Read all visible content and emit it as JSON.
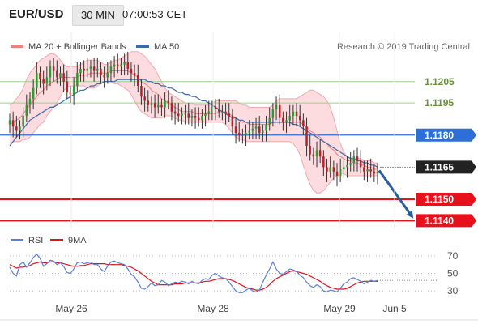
{
  "header": {
    "symbol": "EUR/USD",
    "timeframe": "30 MIN",
    "time": "07:00:53 CET"
  },
  "legend": {
    "ma20_bb": "MA 20 + Bollinger Bands",
    "ma50": "MA 50",
    "credit": "Research © 2019 Trading Central"
  },
  "rsi_legend": {
    "rsi": "RSI",
    "ma9": "9MA"
  },
  "colors": {
    "candle_up": "#2e9a2e",
    "candle_down": "#b8202a",
    "bollinger_fill": "#fbd0d4",
    "bollinger_line": "#f2a8ae",
    "ma20": "#f08080",
    "ma50": "#3a6aa8",
    "support_resistance_green": "#9bd08a",
    "current_level_blue": "#2d6fd6",
    "support_red": "#e8101a",
    "forecast_arrow": "#2a5ca0",
    "current_price_badge": "#222222",
    "rsi": "#5b7fd8",
    "rsi_ma9": "#e8101a"
  },
  "chart_data": [
    {
      "type": "candlestick",
      "title": "EUR/USD 30 MIN",
      "ylim": [
        1.1136,
        1.1228
      ],
      "x_ticks": [
        "May 26",
        "May 28",
        "May 29",
        "Jun 5"
      ],
      "levels": [
        {
          "value": 1.1205,
          "label": "1.1205",
          "style": "green"
        },
        {
          "value": 1.1195,
          "label": "1.1195",
          "style": "green"
        },
        {
          "value": 1.118,
          "label": "1.1180",
          "style": "blue"
        },
        {
          "value": 1.1165,
          "label": "1.1165",
          "style": "current_price"
        },
        {
          "value": 1.115,
          "label": "1.1150",
          "style": "red"
        },
        {
          "value": 1.114,
          "label": "1.1140",
          "style": "red"
        }
      ],
      "current_price": 1.1165,
      "forecast": {
        "from": 1.1165,
        "to": 1.114
      },
      "close": [
        1.1187,
        1.1184,
        1.1182,
        1.1184,
        1.1189,
        1.1194,
        1.1197,
        1.1202,
        1.1209,
        1.1206,
        1.1204,
        1.1207,
        1.1212,
        1.121,
        1.1207,
        1.1209,
        1.1205,
        1.12,
        1.1199,
        1.1203,
        1.1209,
        1.1211,
        1.121,
        1.1211,
        1.1212,
        1.121,
        1.1211,
        1.1208,
        1.1207,
        1.1209,
        1.1212,
        1.1213,
        1.1212,
        1.1213,
        1.1214,
        1.1211,
        1.1209,
        1.1208,
        1.1203,
        1.1198,
        1.1196,
        1.1194,
        1.1195,
        1.1193,
        1.1194,
        1.1193,
        1.1196,
        1.1195,
        1.1191,
        1.119,
        1.1189,
        1.119,
        1.119,
        1.1188,
        1.1189,
        1.1188,
        1.1187,
        1.1189,
        1.119,
        1.1191,
        1.1193,
        1.1192,
        1.1191,
        1.1191,
        1.119,
        1.1189,
        1.1184,
        1.1181,
        1.118,
        1.118,
        1.1181,
        1.1182,
        1.1183,
        1.1184,
        1.1181,
        1.1182,
        1.1185,
        1.1188,
        1.1192,
        1.1194,
        1.1188,
        1.1186,
        1.1187,
        1.1189,
        1.1191,
        1.1189,
        1.1187,
        1.1184,
        1.1175,
        1.1171,
        1.117,
        1.1173,
        1.117,
        1.1165,
        1.1163,
        1.1165,
        1.1163,
        1.1161,
        1.1164,
        1.1165,
        1.1166,
        1.1167,
        1.117,
        1.1168,
        1.1165,
        1.1163,
        1.1164,
        1.1163,
        1.1162,
        1.1163
      ],
      "ma20": [
        1.1185,
        1.1186,
        1.1187,
        1.1188,
        1.119,
        1.1192,
        1.1194,
        1.1196,
        1.1198,
        1.12,
        1.1201,
        1.1203,
        1.1204,
        1.1205,
        1.1206,
        1.1207,
        1.1207,
        1.1207,
        1.1207,
        1.1207,
        1.1207,
        1.1208,
        1.1208,
        1.1208,
        1.1209,
        1.1209,
        1.1209,
        1.1209,
        1.1209,
        1.1209,
        1.121,
        1.121,
        1.121,
        1.121,
        1.121,
        1.121,
        1.1209,
        1.1208,
        1.1207,
        1.1205,
        1.1204,
        1.1203,
        1.1201,
        1.12,
        1.1199,
        1.1197,
        1.1196,
        1.1195,
        1.1194,
        1.1193,
        1.1192,
        1.1191,
        1.1191,
        1.1191,
        1.1191,
        1.119,
        1.119,
        1.119,
        1.119,
        1.119,
        1.119,
        1.119,
        1.1191,
        1.1191,
        1.119,
        1.119,
        1.1189,
        1.1188,
        1.1187,
        1.1186,
        1.1186,
        1.1185,
        1.1185,
        1.1185,
        1.1185,
        1.1185,
        1.1185,
        1.1185,
        1.1186,
        1.1186,
        1.1186,
        1.1186,
        1.1186,
        1.1186,
        1.1186,
        1.1186,
        1.1186,
        1.1185,
        1.1184,
        1.1182,
        1.1181,
        1.118,
        1.1179,
        1.1177,
        1.1176,
        1.1174,
        1.1173,
        1.1171,
        1.117,
        1.1169,
        1.1168,
        1.1168,
        1.1167,
        1.1167,
        1.1166,
        1.1166,
        1.1165,
        1.1165,
        1.1164,
        1.1164
      ],
      "bb_upper": [
        1.1194,
        1.1195,
        1.1197,
        1.1199,
        1.1202,
        1.1206,
        1.1209,
        1.1211,
        1.1213,
        1.1215,
        1.1216,
        1.1217,
        1.1218,
        1.1218,
        1.1217,
        1.1215,
        1.1213,
        1.1212,
        1.1212,
        1.1212,
        1.1212,
        1.1213,
        1.1214,
        1.1215,
        1.1215,
        1.1215,
        1.1215,
        1.1214,
        1.1213,
        1.1213,
        1.1214,
        1.1215,
        1.1215,
        1.1216,
        1.1217,
        1.1218,
        1.1219,
        1.1219,
        1.1219,
        1.1218,
        1.1217,
        1.1215,
        1.1213,
        1.1211,
        1.1208,
        1.1205,
        1.1202,
        1.12,
        1.1199,
        1.1198,
        1.1197,
        1.1196,
        1.1195,
        1.1195,
        1.1195,
        1.1194,
        1.1194,
        1.1194,
        1.1194,
        1.1194,
        1.1195,
        1.1196,
        1.1196,
        1.1196,
        1.1196,
        1.1196,
        1.1196,
        1.1196,
        1.1195,
        1.1194,
        1.1194,
        1.1193,
        1.1193,
        1.1193,
        1.1193,
        1.1193,
        1.1193,
        1.1193,
        1.1194,
        1.1196,
        1.1197,
        1.1197,
        1.1197,
        1.1197,
        1.1197,
        1.1197,
        1.1198,
        1.1199,
        1.12,
        1.1201,
        1.1201,
        1.12,
        1.1199,
        1.1198,
        1.1196,
        1.1193,
        1.1188,
        1.1182,
        1.1176,
        1.1172,
        1.117,
        1.1169,
        1.1169,
        1.1169,
        1.1169,
        1.1168,
        1.1168,
        1.1168,
        1.1167,
        1.1167
      ],
      "bb_lower": [
        1.1176,
        1.1177,
        1.1177,
        1.1177,
        1.1178,
        1.1178,
        1.1179,
        1.1181,
        1.1183,
        1.1185,
        1.1186,
        1.1189,
        1.1191,
        1.1193,
        1.1195,
        1.1198,
        1.1201,
        1.1202,
        1.1203,
        1.1203,
        1.1203,
        1.1203,
        1.1203,
        1.1202,
        1.1202,
        1.1202,
        1.1203,
        1.1204,
        1.1205,
        1.1205,
        1.1205,
        1.1204,
        1.1204,
        1.1203,
        1.1202,
        1.1201,
        1.1199,
        1.1196,
        1.1193,
        1.1191,
        1.119,
        1.1189,
        1.1188,
        1.1188,
        1.1188,
        1.1188,
        1.1189,
        1.1189,
        1.1189,
        1.1188,
        1.1187,
        1.1187,
        1.1186,
        1.1186,
        1.1186,
        1.1186,
        1.1186,
        1.1186,
        1.1186,
        1.1186,
        1.1186,
        1.1186,
        1.1186,
        1.1186,
        1.1185,
        1.1183,
        1.1181,
        1.1179,
        1.1178,
        1.1178,
        1.1177,
        1.1177,
        1.1177,
        1.1177,
        1.1177,
        1.1177,
        1.1177,
        1.1177,
        1.1177,
        1.1177,
        1.1177,
        1.1177,
        1.1177,
        1.1177,
        1.1176,
        1.1174,
        1.1171,
        1.1166,
        1.1161,
        1.1157,
        1.1154,
        1.1153,
        1.1153,
        1.1154,
        1.1156,
        1.1158,
        1.116,
        1.1161,
        1.1162,
        1.1162,
        1.1161,
        1.1161,
        1.1161,
        1.1161,
        1.1161,
        1.1161,
        1.1161,
        1.1161,
        1.1161,
        1.1161
      ],
      "ma50": [
        1.1175,
        1.1177,
        1.1179,
        1.1181,
        1.1183,
        1.1185,
        1.1187,
        1.1188,
        1.1189,
        1.119,
        1.1191,
        1.1192,
        1.1193,
        1.1193,
        1.1194,
        1.1195,
        1.1196,
        1.1197,
        1.1198,
        1.1199,
        1.12,
        1.1201,
        1.1201,
        1.1202,
        1.1203,
        1.1203,
        1.1204,
        1.1204,
        1.1205,
        1.1205,
        1.1205,
        1.1205,
        1.1206,
        1.1206,
        1.1206,
        1.1206,
        1.1206,
        1.1206,
        1.1206,
        1.1206,
        1.1206,
        1.1205,
        1.1205,
        1.1204,
        1.1204,
        1.1203,
        1.1203,
        1.1202,
        1.1202,
        1.1201,
        1.12,
        1.12,
        1.1199,
        1.1199,
        1.1198,
        1.1198,
        1.1197,
        1.1196,
        1.1196,
        1.1195,
        1.1194,
        1.1193,
        1.1192,
        1.1191,
        1.119,
        1.1189,
        1.1188,
        1.1188,
        1.1187,
        1.1187,
        1.1186,
        1.1186,
        1.1186,
        1.1186,
        1.1186,
        1.1186,
        1.1186,
        1.1186,
        1.1186,
        1.1186,
        1.1186,
        1.1186,
        1.1186,
        1.1186,
        1.1185,
        1.1185,
        1.1184,
        1.1183,
        1.1182,
        1.1181,
        1.118,
        1.1179,
        1.1178,
        1.1177,
        1.1176,
        1.1175,
        1.1174,
        1.1173,
        1.1172,
        1.1171,
        1.117,
        1.1169,
        1.1169,
        1.1168,
        1.1168,
        1.1167,
        1.1167,
        1.1166,
        1.1166,
        1.1165
      ]
    },
    {
      "type": "line",
      "series": [
        {
          "name": "RSI"
        },
        {
          "name": "9MA"
        }
      ],
      "ylim": [
        20,
        80
      ],
      "y_ticks": [
        30,
        50,
        70
      ],
      "rsi": [
        57,
        50,
        47,
        60,
        63,
        57,
        62,
        68,
        72,
        67,
        58,
        61,
        65,
        64,
        60,
        62,
        58,
        51,
        50,
        55,
        62,
        63,
        61,
        62,
        63,
        60,
        60,
        55,
        52,
        58,
        63,
        64,
        62,
        61,
        60,
        55,
        49,
        46,
        40,
        33,
        32,
        35,
        39,
        36,
        37,
        42,
        40,
        36,
        38,
        40,
        39,
        41,
        40,
        38,
        41,
        39,
        38,
        42,
        44,
        43,
        48,
        50,
        47,
        45,
        44,
        40,
        35,
        30,
        28,
        28,
        31,
        33,
        30,
        29,
        31,
        40,
        48,
        55,
        63,
        55,
        50,
        49,
        52,
        55,
        54,
        52,
        48,
        45,
        40,
        36,
        34,
        37,
        35,
        30,
        29,
        31,
        30,
        29,
        33,
        38,
        40,
        44,
        45,
        43,
        41,
        38,
        40,
        42,
        41,
        42
      ],
      "rsi_ma9": [
        60,
        58,
        56,
        57,
        57,
        58,
        59,
        61,
        62,
        63,
        62,
        62,
        63,
        63,
        62,
        62,
        61,
        60,
        59,
        58,
        58,
        59,
        59,
        60,
        61,
        61,
        61,
        61,
        61,
        60,
        60,
        60,
        60,
        60,
        59,
        58,
        57,
        55,
        53,
        50,
        47,
        44,
        41,
        39,
        37,
        37,
        37,
        37,
        37,
        38,
        38,
        38,
        39,
        39,
        39,
        39,
        39,
        40,
        41,
        41,
        42,
        43,
        44,
        44,
        44,
        43,
        42,
        40,
        38,
        36,
        34,
        33,
        32,
        31,
        31,
        32,
        34,
        37,
        41,
        44,
        46,
        48,
        50,
        52,
        53,
        52,
        51,
        50,
        49,
        47,
        45,
        43,
        41,
        38,
        36,
        34,
        33,
        32,
        32,
        32,
        33,
        35,
        37,
        39,
        40,
        41,
        41,
        41,
        41,
        41
      ]
    }
  ]
}
